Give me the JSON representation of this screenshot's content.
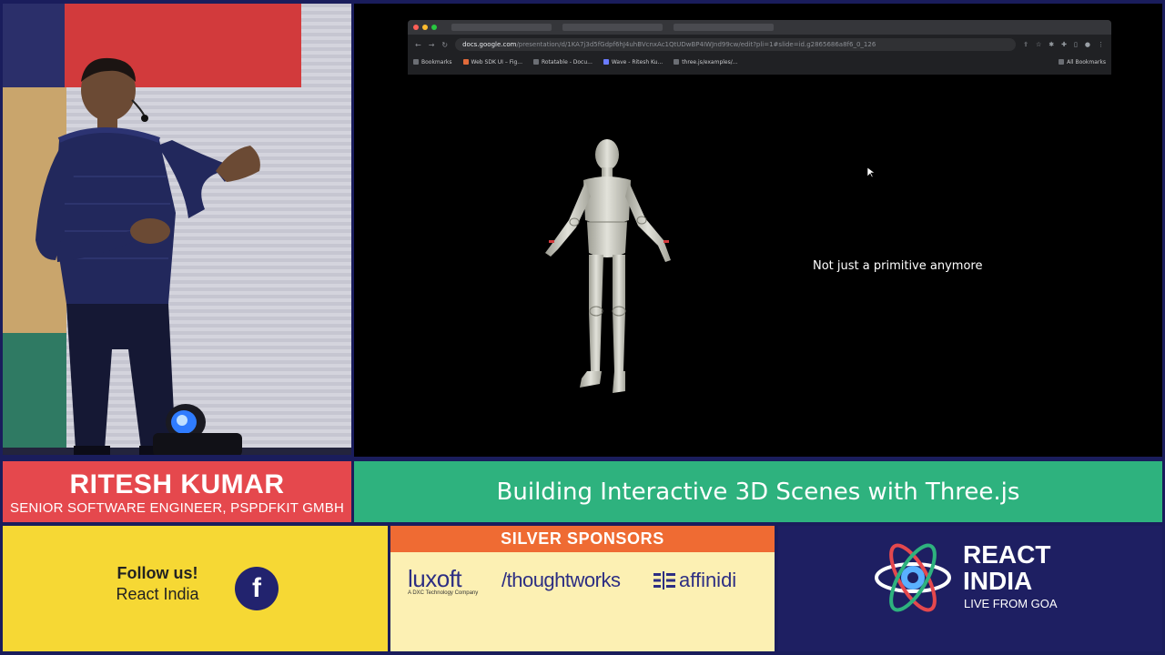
{
  "browser": {
    "url_host": "docs.google.com",
    "url_path": "/presentation/d/1KA7j3d5fGdpf6hJ4uhBVcnxAc1QtUDwBP4IWJnd99cw/edit?pli=1#slide=id.g2865686a8f6_0_126",
    "bookmarks": [
      "Bookmarks",
      "Web SDK UI – Fig...",
      "Rotatable - Docu...",
      "Wave - Ritesh Ku...",
      "three.js/examples/..."
    ],
    "all_bookmarks": "All Bookmarks"
  },
  "slide": {
    "caption": "Not just a primitive anymore"
  },
  "speaker": {
    "name": "RITESH KUMAR",
    "title": "SENIOR SOFTWARE ENGINEER, PSPDFKIT GMBH"
  },
  "talk": {
    "title": "Building Interactive 3D Scenes with Three.js"
  },
  "follow": {
    "heading": "Follow us!",
    "handle": "React India",
    "icon": "facebook-icon",
    "icon_glyph": "f"
  },
  "sponsors": {
    "heading": "SILVER SPONSORS",
    "items": [
      {
        "name": "luxoft",
        "tagline": "A DXC Technology Company"
      },
      {
        "name": "/thoughtworks"
      },
      {
        "name": "affinidi"
      }
    ]
  },
  "brand": {
    "line1": "REACT",
    "line2": "INDIA",
    "tagline": "LIVE FROM GOA"
  },
  "colors": {
    "name_bar": "#e5484d",
    "title_bar": "#2eb27e",
    "follow_bg": "#f6d834",
    "sponsor_header": "#ef6b33",
    "brand_bg": "#1e1f62"
  }
}
